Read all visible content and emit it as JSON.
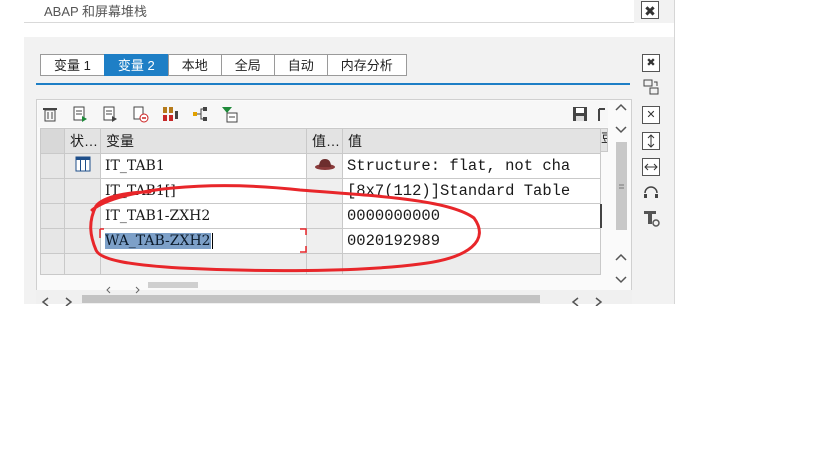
{
  "header": {
    "title": "ABAP 和屏幕堆栈",
    "close_glyph": "✖"
  },
  "tabs": [
    {
      "label": "变量 1",
      "active": false
    },
    {
      "label": "变量 2",
      "active": true
    },
    {
      "label": "本地",
      "active": false
    },
    {
      "label": "全局",
      "active": false
    },
    {
      "label": "自动",
      "active": false
    },
    {
      "label": "内存分析",
      "active": false
    }
  ],
  "grid": {
    "columns": {
      "status": "状…",
      "variable": "变量",
      "val_type": "值…",
      "value": "值",
      "extra": "豆"
    },
    "rows": [
      {
        "variable": "IT_TAB1",
        "value": "Structure: flat, not cha",
        "status_icon": "table-icon",
        "type_icon": "hat-icon"
      },
      {
        "variable": "IT_TAB1[]",
        "value": "[8x7(112)]Standard Table",
        "status_icon": "",
        "type_icon": ""
      },
      {
        "variable": "IT_TAB1-ZXH2",
        "value": "0000000000",
        "status_icon": "",
        "type_icon": ""
      },
      {
        "variable": "WA_TAB-ZXH2",
        "value": "0020192989",
        "status_icon": "",
        "type_icon": ""
      }
    ]
  },
  "colors": {
    "accent": "#1e7fc6",
    "annotation": "#e8262a",
    "selection": "#7da0c8"
  }
}
